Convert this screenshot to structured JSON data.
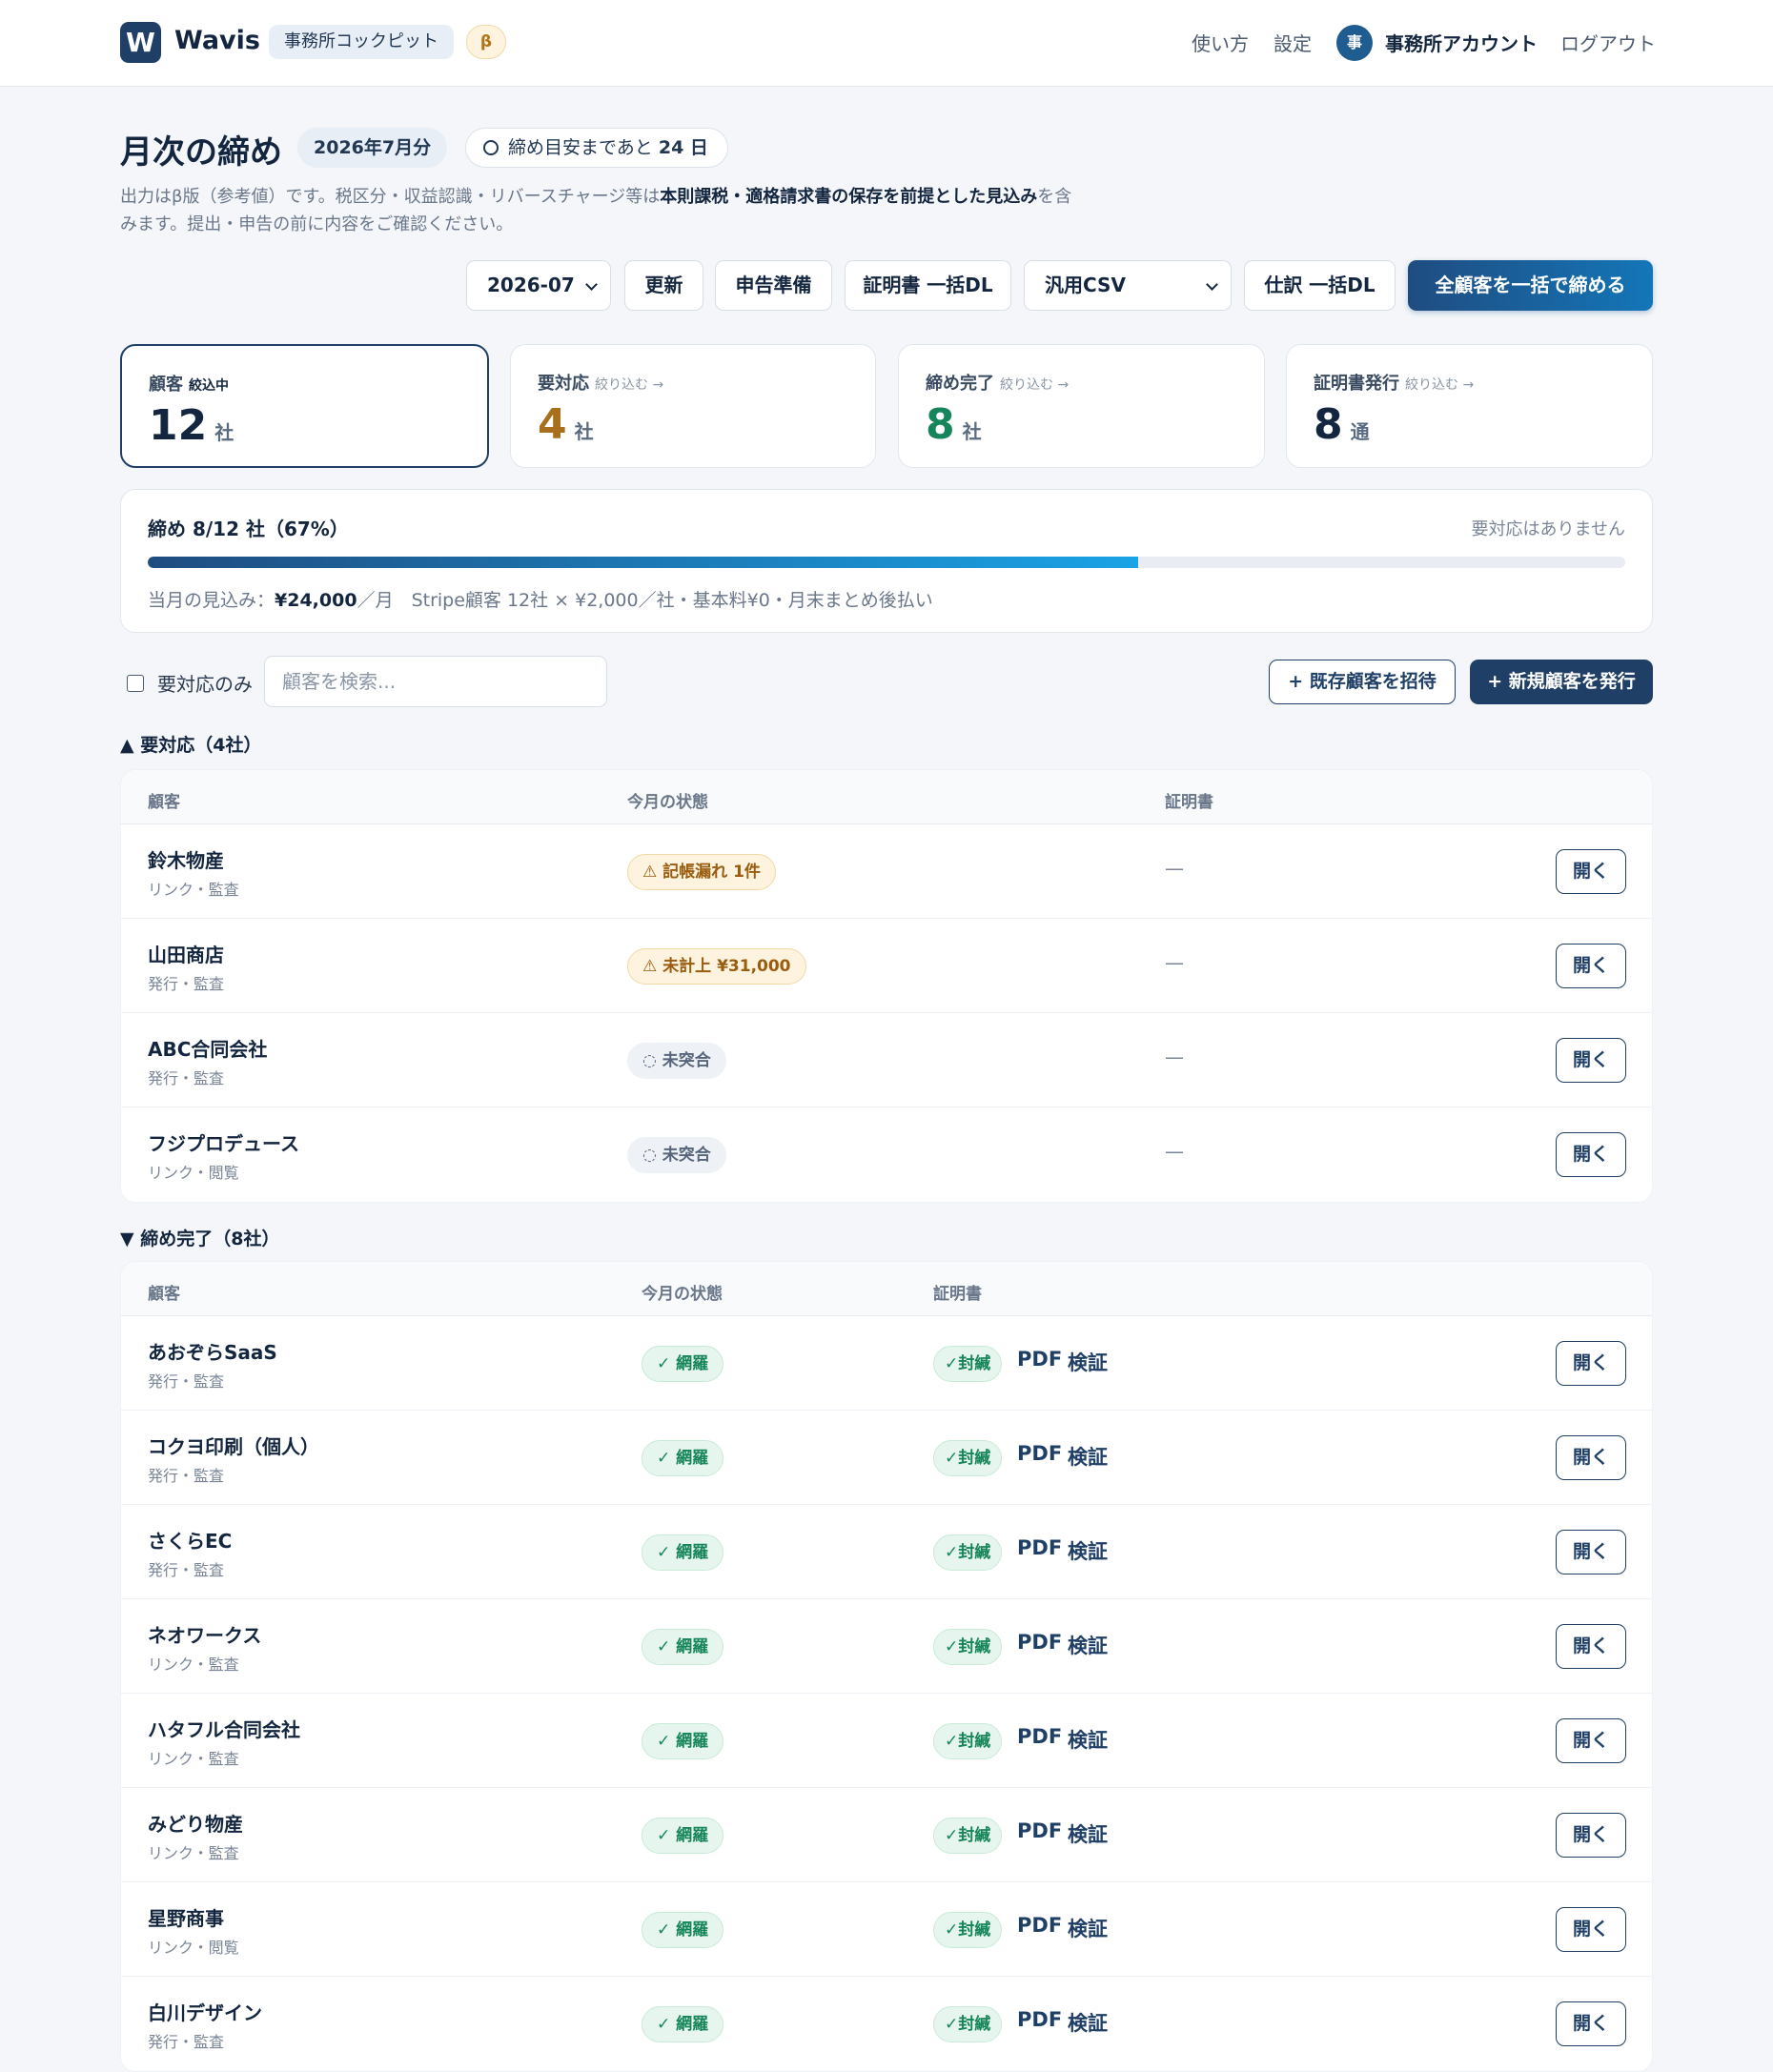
{
  "header": {
    "logo_letter": "W",
    "brand": "Wavis",
    "cockpit_label": "事務所コックピット",
    "beta_label": "β",
    "nav": {
      "howto": "使い方",
      "settings": "設定",
      "account_initial": "事",
      "account_name": "事務所アカウント",
      "logout": "ログアウト"
    }
  },
  "title_area": {
    "title": "月次の締め",
    "month_chip": "2026年7月分",
    "deadline_prefix": "締め目安まであと",
    "deadline_days": "24 日",
    "desc_parts": {
      "a": "出力はβ版（参考値）です。税区分・収益認識・リバースチャージ等は",
      "b": "本則課税・適格請求書の保存を前提とした見込み",
      "c": "を含みます。提出・申告の前に内容をご確認ください。"
    }
  },
  "toolbar": {
    "month_select": "2026-07",
    "refresh": "更新",
    "filing_prep": "申告準備",
    "cert_bulk_dl": "証明書 一括DL",
    "csv_select": "汎用CSV",
    "journal_bulk_dl": "仕訳 一括DL",
    "close_all": "全顧客を一括で締める"
  },
  "stats": [
    {
      "label": "顧客",
      "hint": "絞込中",
      "value": "12",
      "unit": "社",
      "color": "#14263f"
    },
    {
      "label": "要対応",
      "hint": "絞り込む →",
      "value": "4",
      "unit": "社",
      "color": "#a8701a"
    },
    {
      "label": "締め完了",
      "hint": "絞り込む →",
      "value": "8",
      "unit": "社",
      "color": "#17855a"
    },
    {
      "label": "証明書発行",
      "hint": "絞り込む →",
      "value": "8",
      "unit": "通",
      "color": "#14263f"
    }
  ],
  "progress": {
    "title": "締め 8/12 社（67%）",
    "right_note": "要対応はありません",
    "fraction": 0.67,
    "note_prefix": "当月の見込み：",
    "note_amount": "¥24,000",
    "note_suffix": "／月　Stripe顧客 12社 × ¥2,000／社・基本料¥0・月末まとめ後払い"
  },
  "filters": {
    "needs_action_only": "要対応のみ",
    "search_placeholder": "顧客を検索...",
    "invite_existing": "+ 既存顧客を招待",
    "issue_new": "+ 新規顧客を発行"
  },
  "section_pending": {
    "title": "▲ 要対応（4社）",
    "columns": {
      "customer": "顧客",
      "status": "今月の状態",
      "cert": "証明書"
    },
    "rows": [
      {
        "name": "鈴木物産",
        "sub": "リンク・監査",
        "status": "⚠ 記帳漏れ 1件",
        "kind": "warn",
        "cert": "—",
        "action": "開く"
      },
      {
        "name": "山田商店",
        "sub": "発行・監査",
        "status": "⚠ 未計上 ¥31,000",
        "kind": "warn",
        "cert": "—",
        "action": "開く"
      },
      {
        "name": "ABC合同会社",
        "sub": "発行・監査",
        "status": "◌ 未突合",
        "kind": "pending",
        "cert": "—",
        "action": "開く"
      },
      {
        "name": "フジプロデュース",
        "sub": "リンク・閲覧",
        "status": "◌ 未突合",
        "kind": "pending",
        "cert": "—",
        "action": "開く"
      }
    ]
  },
  "section_done": {
    "title": "▼ 締め完了（8社）",
    "columns": {
      "customer": "顧客",
      "status": "今月の状態",
      "cert": "証明書"
    },
    "rows": [
      {
        "name": "あおぞらSaaS",
        "sub": "発行・監査",
        "status": "✓ 網羅",
        "seal": "✓封緘",
        "pdf": "PDF",
        "verify": "検証",
        "action": "開く"
      },
      {
        "name": "コクヨ印刷（個人）",
        "sub": "発行・監査",
        "status": "✓ 網羅",
        "seal": "✓封緘",
        "pdf": "PDF",
        "verify": "検証",
        "action": "開く"
      },
      {
        "name": "さくらEC",
        "sub": "発行・監査",
        "status": "✓ 網羅",
        "seal": "✓封緘",
        "pdf": "PDF",
        "verify": "検証",
        "action": "開く"
      },
      {
        "name": "ネオワークス",
        "sub": "リンク・監査",
        "status": "✓ 網羅",
        "seal": "✓封緘",
        "pdf": "PDF",
        "verify": "検証",
        "action": "開く"
      },
      {
        "name": "ハタフル合同会社",
        "sub": "リンク・監査",
        "status": "✓ 網羅",
        "seal": "✓封緘",
        "pdf": "PDF",
        "verify": "検証",
        "action": "開く"
      },
      {
        "name": "みどり物産",
        "sub": "リンク・監査",
        "status": "✓ 網羅",
        "seal": "✓封緘",
        "pdf": "PDF",
        "verify": "検証",
        "action": "開く"
      },
      {
        "name": "星野商事",
        "sub": "リンク・閲覧",
        "status": "✓ 網羅",
        "seal": "✓封緘",
        "pdf": "PDF",
        "verify": "検証",
        "action": "開く"
      },
      {
        "name": "白川デザイン",
        "sub": "発行・監査",
        "status": "✓ 網羅",
        "seal": "✓封緘",
        "pdf": "PDF",
        "verify": "検証",
        "action": "開く"
      }
    ]
  }
}
